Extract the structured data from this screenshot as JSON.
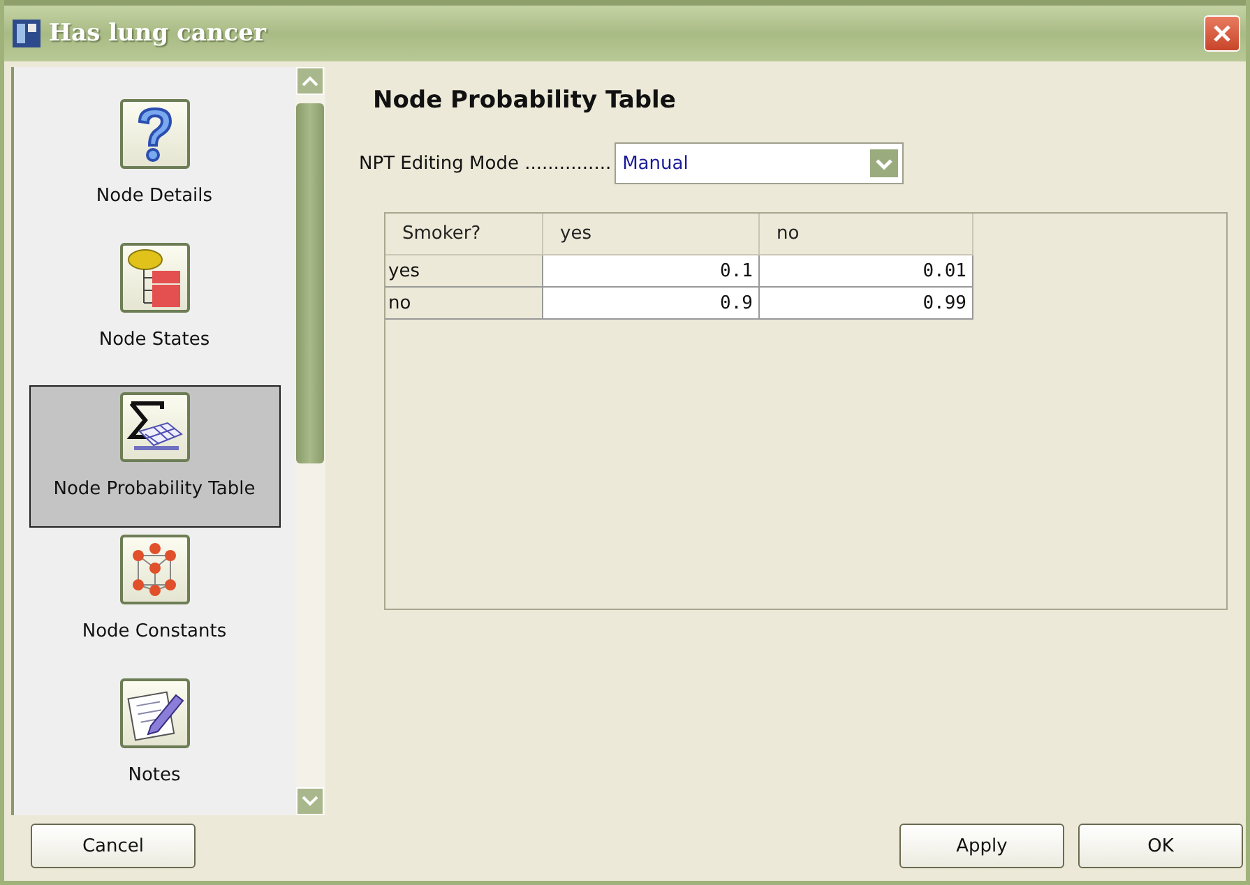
{
  "window": {
    "title": "Has lung cancer"
  },
  "sidebar": {
    "items": [
      {
        "label": "Node Details",
        "kind": "details",
        "selected": false
      },
      {
        "label": "Node States",
        "kind": "states",
        "selected": false
      },
      {
        "label": "Node Probability Table",
        "kind": "table",
        "selected": true
      },
      {
        "label": "Node Constants",
        "kind": "constants",
        "selected": false
      },
      {
        "label": "Notes",
        "kind": "notes",
        "selected": false
      }
    ]
  },
  "content": {
    "title": "Node Probability Table",
    "editing_mode": {
      "label": "NPT Editing Mode ...............",
      "value": "Manual"
    },
    "table": {
      "columns": [
        "Smoker?",
        "yes",
        "no"
      ],
      "rows": [
        {
          "state": "yes",
          "cells": [
            "0.1",
            "0.01"
          ]
        },
        {
          "state": "no",
          "cells": [
            "0.9",
            "0.99"
          ]
        }
      ]
    }
  },
  "left_buttons": [
    "Cancel"
  ],
  "right_buttons": [
    "Apply",
    "OK"
  ]
}
